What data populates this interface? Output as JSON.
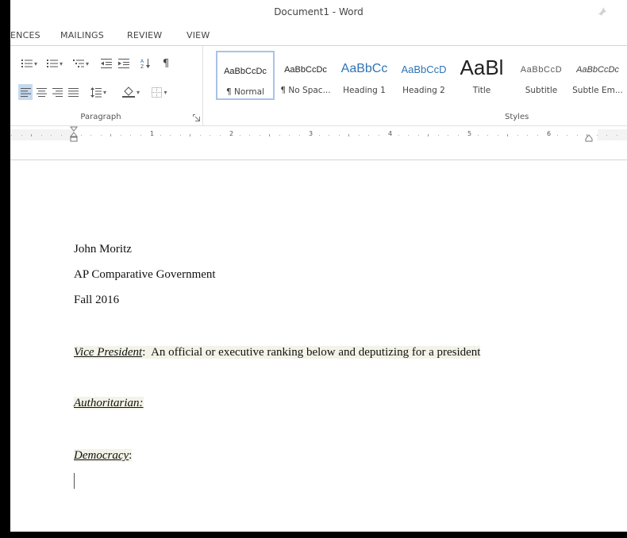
{
  "window": {
    "title": "Document1 - Word"
  },
  "tabs": [
    "ENCES",
    "MAILINGS",
    "REVIEW",
    "VIEW"
  ],
  "ribbon": {
    "paragraph_group_label": "Paragraph",
    "styles_group_label": "Styles",
    "styles": [
      {
        "preview": "AaBbCcDc",
        "name": "¶ Normal",
        "selected": true
      },
      {
        "preview": "AaBbCcDc",
        "name": "¶ No Spac..."
      },
      {
        "preview": "AaBbCc",
        "name": "Heading 1",
        "color": "#2e74b5"
      },
      {
        "preview": "AaBbCcD",
        "name": "Heading 2",
        "color": "#2e74b5"
      },
      {
        "preview": "AaBl",
        "name": "Title"
      },
      {
        "preview": "AaBbCcD",
        "name": "Subtitle",
        "color": "#595959"
      },
      {
        "preview": "AaBbCcDc",
        "name": "Subtle Em...",
        "color": "#404040"
      }
    ]
  },
  "ruler": {
    "numbers": [
      "1",
      "2",
      "3",
      "4",
      "5",
      "6"
    ]
  },
  "document": {
    "header_lines": [
      "John Moritz",
      "AP Comparative Government",
      "Fall 2016"
    ],
    "definitions": [
      {
        "term": "Vice President",
        "separator": ":",
        "definition": "  An official or executive ranking below and deputizing for a president"
      },
      {
        "term": "Authoritarian:",
        "separator": "",
        "definition": ""
      },
      {
        "term": "Democracy",
        "separator": ":",
        "definition": ""
      }
    ]
  }
}
